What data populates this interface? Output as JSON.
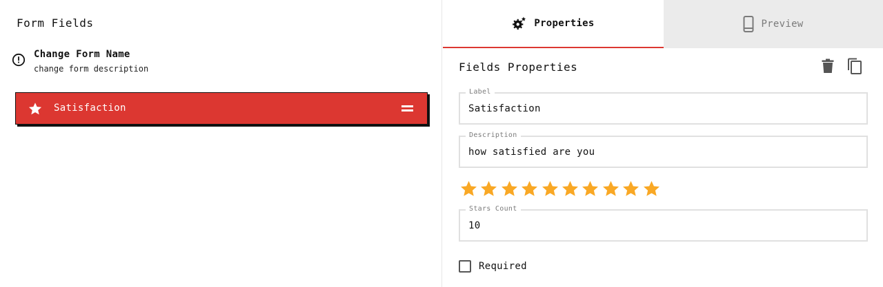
{
  "left": {
    "title": "Form Fields",
    "form": {
      "name": "Change Form Name",
      "description": "change form description",
      "info_icon": "info-circle-icon"
    },
    "fields": [
      {
        "label": "Satisfaction",
        "icon": "star-icon",
        "selected": true
      }
    ]
  },
  "tabs": [
    {
      "label": "Properties",
      "icon": "gear-icon",
      "active": true
    },
    {
      "label": "Preview",
      "icon": "phone-icon",
      "active": false
    }
  ],
  "properties": {
    "title": "Fields Properties",
    "actions": {
      "delete_icon": "trash-icon",
      "copy_icon": "copy-icon"
    },
    "label_field": {
      "legend": "Label",
      "value": "Satisfaction"
    },
    "description_field": {
      "legend": "Description",
      "value": "how satisfied are you"
    },
    "rating": {
      "count": 10,
      "selected": 10
    },
    "stars_count_field": {
      "legend": "Stars Count",
      "value": "10"
    },
    "required": {
      "label": "Required",
      "checked": false
    }
  },
  "colors": {
    "accent": "#dc3731",
    "star": "#f9a825",
    "tab_inactive_bg": "#ebebeb"
  }
}
